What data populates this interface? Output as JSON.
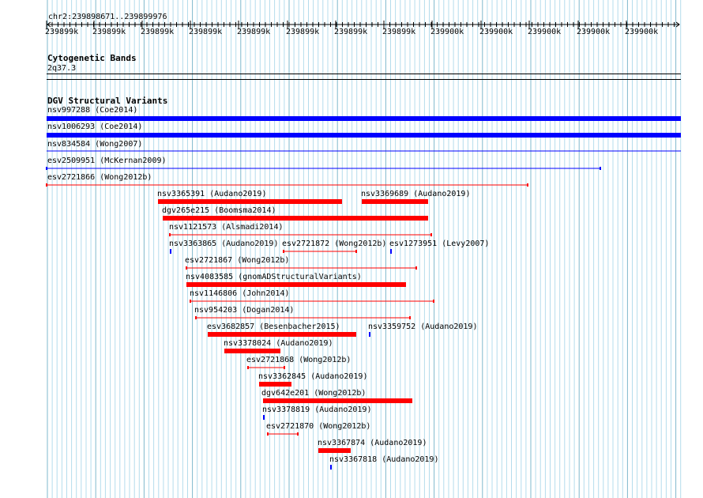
{
  "location": "chr2:239898671..239899976",
  "ruler": {
    "tick_labels": [
      "239899k",
      "239899k",
      "239899k",
      "239899k",
      "239899k",
      "239899k",
      "239899k",
      "239899k",
      "239900k",
      "239900k",
      "239900k",
      "239900k",
      "239900k"
    ]
  },
  "tracks": {
    "cytoband": {
      "title": "Cytogenetic Bands",
      "band": "2q37.3"
    },
    "dgv": {
      "title": "DGV Structural Variants"
    }
  },
  "features": [
    {
      "label": "nsv997288 (Coe2014)",
      "color": "#0000ff",
      "style": "thick"
    },
    {
      "label": "nsv1006293 (Coe2014)",
      "color": "#0000ff",
      "style": "thick"
    },
    {
      "label": "nsv834584 (Wong2007)",
      "color": "#0000ff",
      "style": "thin"
    },
    {
      "label": "esv2509951 (McKernan2009)",
      "color": "#0000ff",
      "style": "capped"
    },
    {
      "label": "esv2721866 (Wong2012b)",
      "color": "#ff0000",
      "style": "capped"
    },
    {
      "label": "nsv3365391 (Audano2019)",
      "color": "#ff0000",
      "style": "thick"
    },
    {
      "label": "nsv3369689 (Audano2019)",
      "color": "#ff0000",
      "style": "thick"
    },
    {
      "label": "dgv265e215 (Boomsma2014)",
      "color": "#ff0000",
      "style": "thick"
    },
    {
      "label": "nsv1121573 (Alsmadi2014)",
      "color": "#ff0000",
      "style": "capped"
    },
    {
      "label": "nsv3363865 (Audano2019)",
      "color": "#0000ff",
      "style": "tick"
    },
    {
      "label": "esv2721872 (Wong2012b)",
      "color": "#ff0000",
      "style": "capped"
    },
    {
      "label": "esv1273951 (Levy2007)",
      "color": "#0000ff",
      "style": "tick"
    },
    {
      "label": "esv2721867 (Wong2012b)",
      "color": "#ff0000",
      "style": "capped"
    },
    {
      "label": "nsv4083585 (gnomADStructuralVariants)",
      "color": "#ff0000",
      "style": "thick"
    },
    {
      "label": "nsv1146806 (John2014)",
      "color": "#ff0000",
      "style": "capped"
    },
    {
      "label": "nsv954203 (Dogan2014)",
      "color": "#ff0000",
      "style": "capped"
    },
    {
      "label": "esv3682857 (Besenbacher2015)",
      "color": "#ff0000",
      "style": "thick"
    },
    {
      "label": "nsv3359752 (Audano2019)",
      "color": "#0000ff",
      "style": "tick"
    },
    {
      "label": "nsv3378024 (Audano2019)",
      "color": "#ff0000",
      "style": "thick"
    },
    {
      "label": "esv2721868 (Wong2012b)",
      "color": "#ff0000",
      "style": "capped"
    },
    {
      "label": "nsv3362845 (Audano2019)",
      "color": "#ff0000",
      "style": "thick"
    },
    {
      "label": "dgv642e201 (Wong2012b)",
      "color": "#ff0000",
      "style": "thick"
    },
    {
      "label": "nsv3378819 (Audano2019)",
      "color": "#0000ff",
      "style": "tick"
    },
    {
      "label": "esv2721870 (Wong2012b)",
      "color": "#ff0000",
      "style": "capped"
    },
    {
      "label": "nsv3367874 (Audano2019)",
      "color": "#ff0000",
      "style": "thick"
    },
    {
      "label": "nsv3367818 (Audano2019)",
      "color": "#0000ff",
      "style": "tick"
    }
  ],
  "colors": {
    "grid": "#b4dcec",
    "grid_major": "#7fb8cc"
  }
}
